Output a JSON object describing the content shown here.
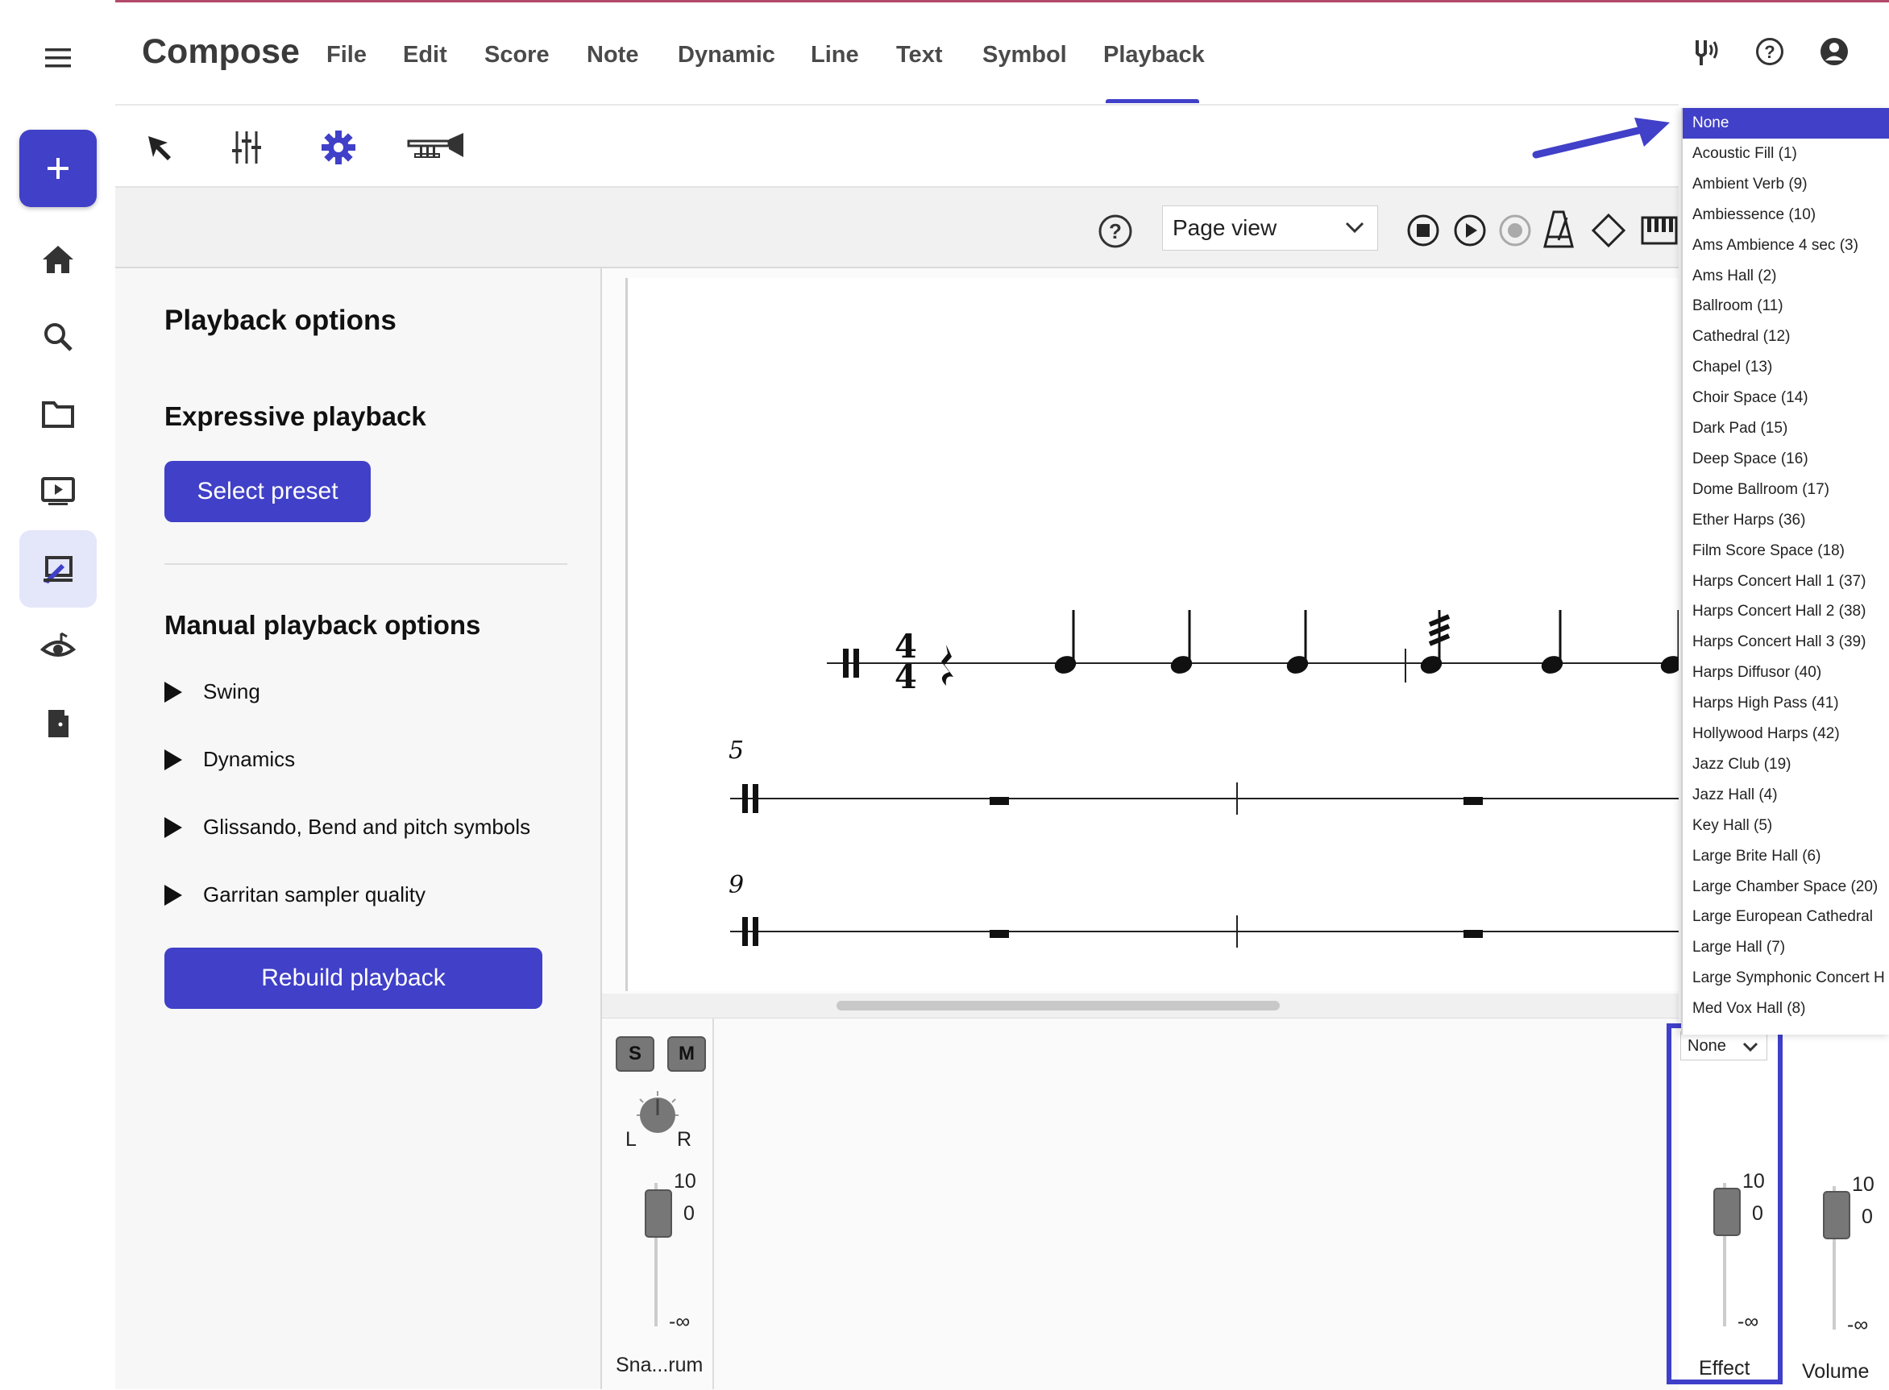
{
  "app": {
    "title": "Compose"
  },
  "menu": [
    "File",
    "Edit",
    "Score",
    "Note",
    "Dynamic",
    "Line",
    "Text",
    "Symbol",
    "Playback"
  ],
  "menu_active": "Playback",
  "accent_color": "#4040c8",
  "toolbar_icons": [
    "select-arrow-icon",
    "mixer-icon",
    "settings-gear-icon",
    "trumpet-icon"
  ],
  "view": {
    "selected": "Page view"
  },
  "options": {
    "title": "Playback options",
    "expressive_title": "Expressive playback",
    "select_preset_label": "Select preset",
    "manual_title": "Manual playback options",
    "sections": [
      "Swing",
      "Dynamics",
      "Glissando, Bend and pitch symbols",
      "Garritan sampler quality"
    ],
    "rebuild_label": "Rebuild playback"
  },
  "score": {
    "time_signature": {
      "top": "4",
      "bottom": "4"
    },
    "measure_numbers": [
      "5",
      "9"
    ]
  },
  "mixer": {
    "solo_label": "S",
    "mute_label": "M",
    "pan_left": "L",
    "pan_right": "R",
    "channel": {
      "label": "Sna...rum",
      "max": "10",
      "zero": "0",
      "min": "-∞"
    },
    "effect": {
      "label": "Effect",
      "select": "None",
      "max": "10",
      "zero": "0",
      "min": "-∞"
    },
    "volume": {
      "label": "Volume",
      "max": "10",
      "zero": "0",
      "min": "-∞"
    }
  },
  "reverb_dropdown": {
    "selected": "None",
    "items": [
      "None",
      "Acoustic Fill (1)",
      "Ambient Verb (9)",
      "Ambiessence (10)",
      "Ams Ambience 4 sec (3)",
      "Ams Hall (2)",
      "Ballroom (11)",
      "Cathedral (12)",
      "Chapel (13)",
      "Choir Space (14)",
      "Dark Pad (15)",
      "Deep Space (16)",
      "Dome Ballroom (17)",
      "Ether Harps (36)",
      "Film Score Space (18)",
      "Harps Concert Hall 1 (37)",
      "Harps Concert Hall 2 (38)",
      "Harps Concert Hall 3 (39)",
      "Harps Diffusor (40)",
      "Harps High Pass (41)",
      "Hollywood Harps (42)",
      "Jazz Club (19)",
      "Jazz Hall (4)",
      "Key Hall (5)",
      "Large Brite Hall (6)",
      "Large Chamber Space (20)",
      "Large European Cathedral",
      "Large Hall (7)",
      "Large Symphonic Concert H",
      "Med Vox Hall (8)"
    ]
  }
}
